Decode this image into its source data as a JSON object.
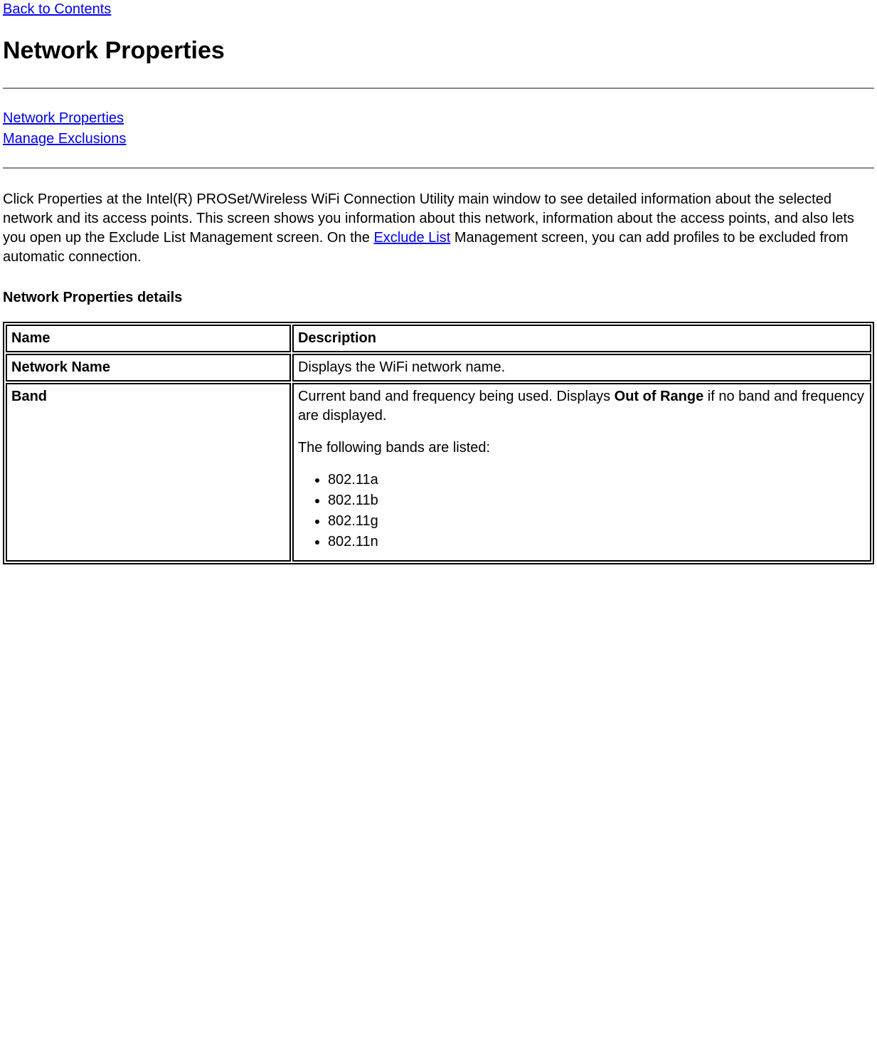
{
  "nav": {
    "back_link": "Back to Contents"
  },
  "heading": "Network Properties",
  "toc": {
    "link1": "Network Properties",
    "link2": "Manage Exclusions"
  },
  "intro": {
    "part1": "Click Properties at the Intel(R) PROSet/Wireless WiFi Connection Utility main window to see detailed information about the selected network and its access points. This screen shows you information about this network, information about the access points, and also lets you open up the Exclude List Management screen. On the ",
    "link": "Exclude List",
    "part2": " Management screen, you can add profiles to be excluded from automatic connection."
  },
  "subhead": "Network Properties details",
  "table": {
    "header_name": "Name",
    "header_desc": "Description",
    "row1_name": "Network Name",
    "row1_desc": "Displays the WiFi network name.",
    "row2_name": "Band",
    "row2_desc_line1a": "Current band and frequency being used. Displays ",
    "row2_desc_line1b": "Out of Range",
    "row2_desc_line1c": " if no band and frequency are displayed.",
    "row2_desc_line2": "The following bands are listed:",
    "row2_bands": {
      "b1": "802.11a",
      "b2": "802.11b",
      "b3": "802.11g",
      "b4": "802.11n"
    }
  }
}
